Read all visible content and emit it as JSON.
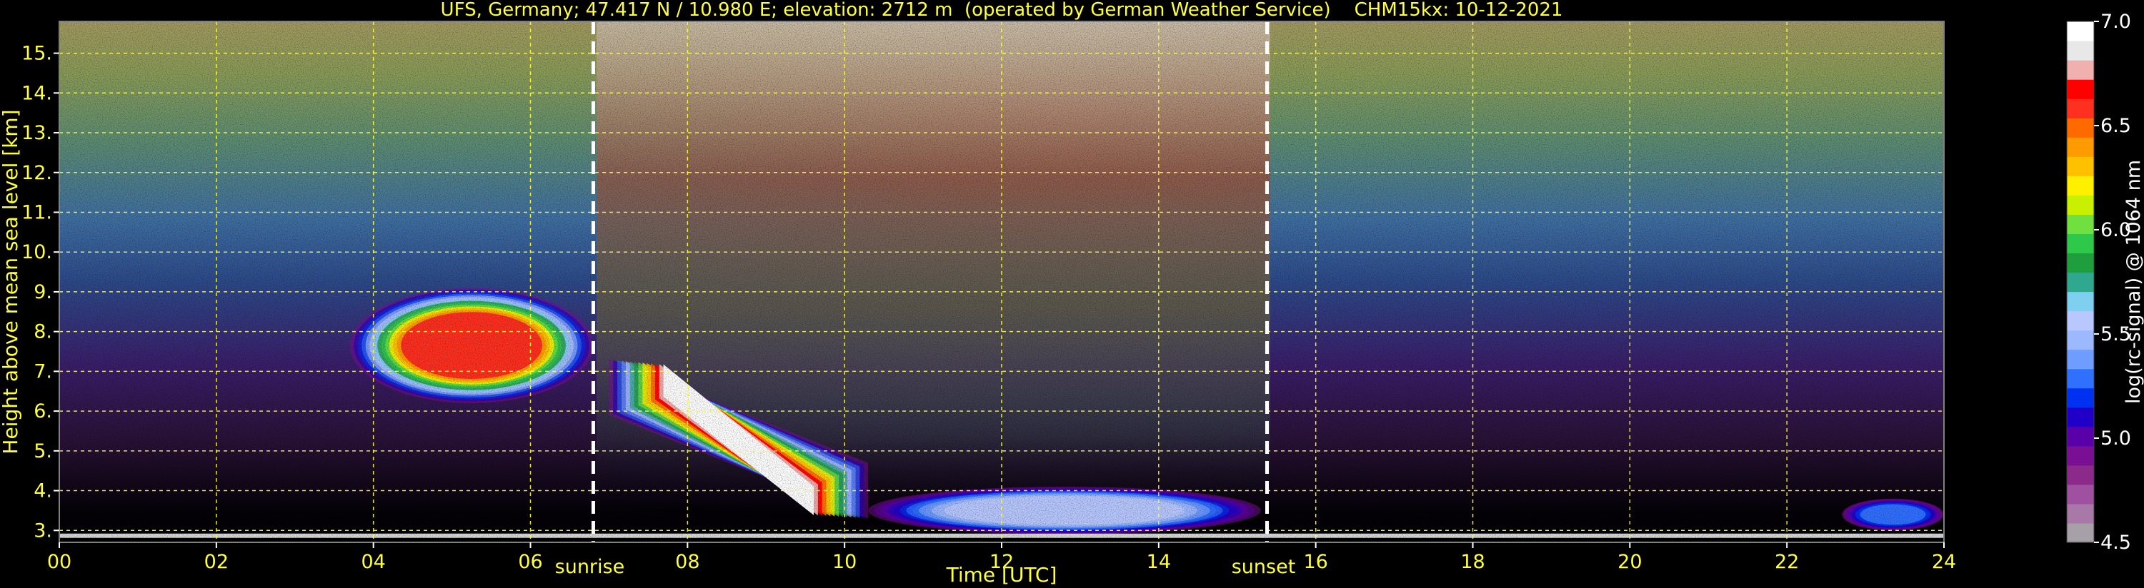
{
  "chart_data": {
    "type": "heatmap",
    "title": "UFS, Germany; 47.417 N / 10.980 E; elevation: 2712 m  (operated by German Weather Service)    CHM15kx: 10-12-2021",
    "xlabel": "Time [UTC]",
    "ylabel": "Height above mean sea level [km]",
    "x_ticks": [
      "00",
      "02",
      "04",
      "06",
      "08",
      "10",
      "12",
      "14",
      "16",
      "18",
      "20",
      "22",
      "24"
    ],
    "xlim": [
      0,
      24
    ],
    "y_ticks": [
      "3.",
      "4.",
      "5.",
      "6.",
      "7.",
      "8.",
      "9.",
      "10.",
      "11.",
      "12.",
      "13.",
      "14.",
      "15."
    ],
    "ylim": [
      2.7,
      15.8
    ],
    "grid": true,
    "markers": [
      {
        "label": "sunrise",
        "time": 6.8
      },
      {
        "label": "sunset",
        "time": 15.38
      }
    ],
    "colorbar": {
      "label": "log(rc-signal) @ 1064 nm",
      "ticks": [
        "7.0",
        "6.5",
        "6.0",
        "5.5",
        "5.0",
        "4.5"
      ],
      "range": [
        4.5,
        7.0
      ]
    },
    "cloud_layers": [
      {
        "t_start": 3.7,
        "t_end": 6.8,
        "base_km": 6.2,
        "top_km": 9.1,
        "peak_log": 6.6
      },
      {
        "t_start": 7.0,
        "t_end": 10.3,
        "base_km": 3.3,
        "top_km": 7.3,
        "peak_log": 7.0
      },
      {
        "t_start": 10.3,
        "t_end": 15.3,
        "base_km": 2.9,
        "top_km": 4.1,
        "peak_log": 5.6
      },
      {
        "t_start": 22.7,
        "t_end": 24.0,
        "base_km": 3.0,
        "top_km": 3.8,
        "peak_log": 5.3
      }
    ]
  },
  "colors": {
    "axis_text": "#ffff3c",
    "grid": "#ffff3c",
    "colorbar_stops": [
      "#a8a0a8",
      "#a878a8",
      "#a050a0",
      "#8c2a8c",
      "#7a0f96",
      "#5a00a8",
      "#2000c8",
      "#0030f0",
      "#3070ff",
      "#6f9cff",
      "#9cb8ff",
      "#b8c8ff",
      "#7fd0f0",
      "#30a890",
      "#1e9e3c",
      "#2ec84a",
      "#70e040",
      "#c8f000",
      "#fff000",
      "#ffc000",
      "#ff9a00",
      "#ff6a00",
      "#ff3020",
      "#ff0000",
      "#f0b0b0",
      "#e8e8e8",
      "#ffffff"
    ]
  }
}
